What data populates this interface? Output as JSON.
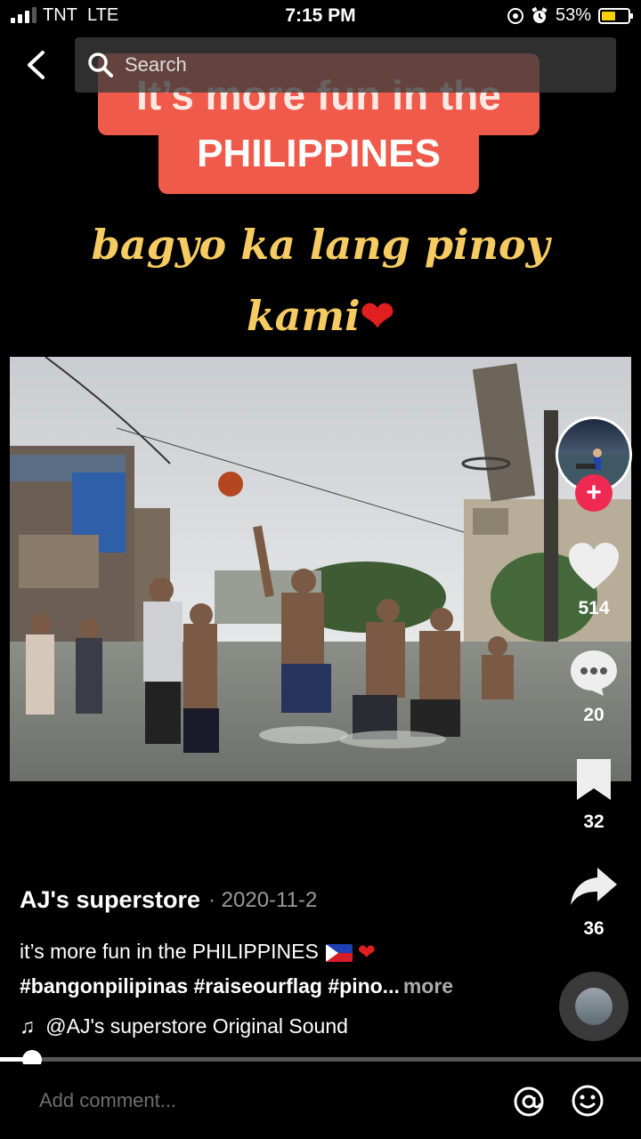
{
  "status_bar": {
    "carrier": "TNT",
    "network": "LTE",
    "time": "7:15 PM",
    "battery_percent": "53%",
    "signal_bars": 3,
    "battery_level": 0.53,
    "battery_color": "#f5d000"
  },
  "top_bar": {
    "search_placeholder": "Search"
  },
  "video": {
    "banner_line1": "It’s more fun in the",
    "banner_line2": "PHILIPPINES",
    "script_line1": "bagyo ka lang pinoy",
    "script_line2": "kami",
    "heart_glyph": "❤",
    "banner_color": "#ef5a4a",
    "script_color": "#f6cc62"
  },
  "rail": {
    "likes": "514",
    "comments": "20",
    "saves": "32",
    "shares": "36",
    "follow_glyph": "+",
    "accent": "#ee2a53"
  },
  "caption": {
    "author": "AJ's superstore",
    "date": "· 2020-11-2",
    "text": "it’s more fun in the PHILIPPINES",
    "heart_glyph": "❤",
    "hashtags": "#bangonpilipinas #raiseourflag #pino...",
    "more_label": "more",
    "sound": "@AJ's superstore Original Sound",
    "sound_glyph": "♫"
  },
  "playback": {
    "progress": 0.05
  },
  "comment_bar": {
    "placeholder": "Add comment..."
  },
  "icons": [
    "signal-icon",
    "alarm-icon",
    "lock-rotation-icon",
    "battery-icon",
    "back-icon",
    "search-icon",
    "heart-icon",
    "comment-icon",
    "bookmark-icon",
    "share-icon",
    "music-note-icon",
    "at-icon",
    "emoji-icon"
  ]
}
